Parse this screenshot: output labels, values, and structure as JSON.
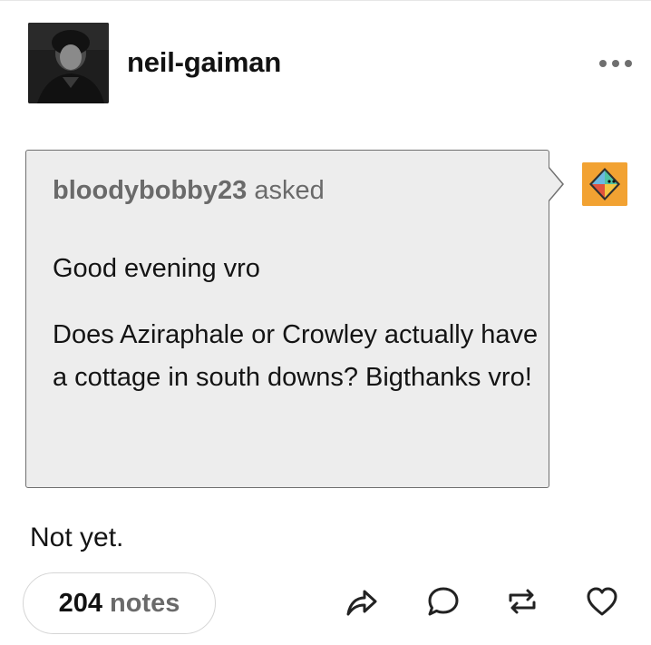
{
  "post": {
    "blog_name": "neil-gaiman",
    "avatar_icon": "blog-avatar-photo",
    "more_icon": "more-dots-icon"
  },
  "ask": {
    "asker": "bloodybobby23",
    "asked_label": "asked",
    "question_lines": [
      "Good evening vro",
      "Does Aziraphale or Crowley actually have a cottage in south downs? Bigthanks vro!"
    ],
    "asker_avatar_icon": "asker-avatar-icon",
    "asker_avatar_color": "#f2a232"
  },
  "answer": {
    "text": "Not yet."
  },
  "footer": {
    "notes_count": "204",
    "notes_label": "notes",
    "actions": [
      "share-icon",
      "reply-icon",
      "reblog-icon",
      "like-icon"
    ]
  }
}
